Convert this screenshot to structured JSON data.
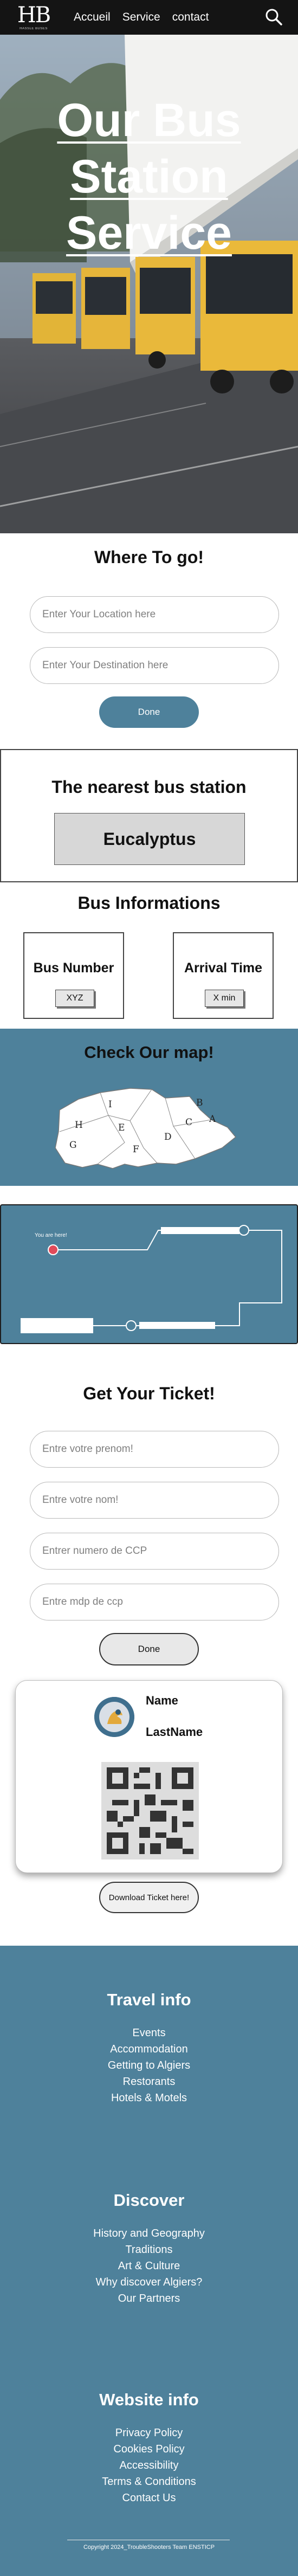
{
  "nav": {
    "logo_text": "HB",
    "logo_subtext": "HASSLE BUSES",
    "links": [
      "Accueil",
      "Service",
      "contact"
    ],
    "search_icon": "search-icon"
  },
  "hero": {
    "title_lines": [
      "Our Bus",
      "Station",
      "Service"
    ]
  },
  "where": {
    "title": "Where To go!",
    "location_placeholder": "Enter Your Location here",
    "destination_placeholder": "Enter Your Destination here",
    "done_label": "Done"
  },
  "nearest": {
    "title": "The nearest bus station",
    "station": "Eucalyptus"
  },
  "bus_info": {
    "title": "Bus Informations",
    "bus_number_label": "Bus Number",
    "bus_number_value": "XYZ",
    "arrival_label": "Arrival Time",
    "arrival_value": "X min"
  },
  "map": {
    "title": "Check Our map!",
    "regions": [
      "I",
      "B",
      "H",
      "E",
      "C",
      "A",
      "D",
      "G",
      "F"
    ]
  },
  "route": {
    "you_are_here": "You are here!"
  },
  "ticket_form": {
    "title": "Get Your Ticket!",
    "prenom_placeholder": "Entre votre prenom!",
    "nom_placeholder": "Entre votre nom!",
    "ccp_placeholder": "Entrer numero de CCP",
    "mdp_placeholder": "Entre mdp de ccp",
    "done_label": "Done"
  },
  "ticket_card": {
    "name": "Name",
    "lastname": "LastName",
    "download_label": "Download Ticket here!"
  },
  "footer": {
    "travel": {
      "title": "Travel info",
      "links": [
        "Events",
        "Accommodation",
        "Getting to Algiers",
        "Restorants",
        "Hotels & Motels"
      ]
    },
    "discover": {
      "title": "Discover",
      "links": [
        "History and Geography",
        "Traditions",
        "Art & Culture",
        "Why discover Algiers?",
        "Our Partners"
      ]
    },
    "website": {
      "title": "Website info",
      "links": [
        "Privacy Policy",
        "Cookies Policy",
        "Accessibility",
        "Terms & Conditions",
        "Contact Us"
      ]
    },
    "copyright": "Copyright 2024_TroubleShooters Team ENSTICP"
  },
  "colors": {
    "accent": "#4e819b",
    "nav_bg": "#141414",
    "station_box": "#d7d7d7"
  }
}
